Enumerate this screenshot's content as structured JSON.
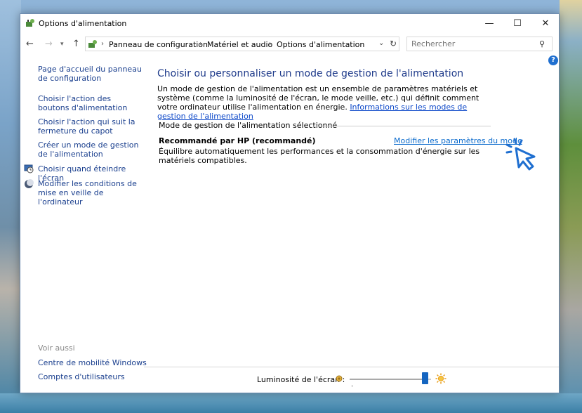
{
  "window": {
    "title": "Options d'alimentation",
    "minimize_symbol": "—",
    "maximize_symbol": "☐",
    "close_symbol": "✕"
  },
  "address": {
    "back_symbol": "←",
    "forward_symbol": "→",
    "dropdown_symbol": "▾",
    "up_symbol": "↑",
    "breadcrumbs": [
      "Panneau de configuration",
      "Matériel et audio",
      "Options d'alimentation"
    ],
    "separator": "›",
    "dropdown_arrow": "⌄",
    "refresh_symbol": "↻"
  },
  "search": {
    "placeholder": "Rechercher",
    "icon_symbol": "⚲"
  },
  "help": {
    "symbol": "?"
  },
  "sidebar": {
    "items": [
      {
        "label": "Page d'accueil du panneau de configuration",
        "icon": null
      },
      {
        "label": "Choisir l'action des boutons d'alimentation",
        "icon": null
      },
      {
        "label": "Choisir l'action qui suit la fermeture du capot",
        "icon": null
      },
      {
        "label": "Créer un mode de gestion de l'alimentation",
        "icon": null
      },
      {
        "label": "Choisir quand éteindre l'écran",
        "icon": "monitor-clock-icon"
      },
      {
        "label": "Modifier les conditions de mise en veille de l'ordinateur",
        "icon": "moon-icon"
      }
    ],
    "see_also_title": "Voir aussi",
    "see_also": [
      "Centre de mobilité Windows",
      "Comptes d'utilisateurs"
    ]
  },
  "main": {
    "title": "Choisir ou personnaliser un mode de gestion de l'alimentation",
    "description": "Un mode de gestion de l'alimentation est un ensemble de paramètres matériels et système (comme la luminosité de l'écran, le mode veille, etc.) qui définit comment votre ordinateur utilise l'alimentation en énergie.",
    "info_link": "Informations sur les modes de gestion de l'alimentation",
    "section_label": "Mode de gestion de l'alimentation sélectionné",
    "plan_name": "Recommandé par HP (recommandé)",
    "plan_link": "Modifier les paramètres du mode",
    "plan_description": "Équilibre automatiquement les performances et la consommation d'énergie sur les matériels compatibles."
  },
  "brightness": {
    "label": "Luminosité de l'écran :",
    "value_fraction": 0.93
  },
  "colors": {
    "title_blue": "#1e3a8a",
    "link_blue": "#1a3f8e",
    "accent": "#1565c0",
    "cursor_blue": "#1f6fd0"
  }
}
